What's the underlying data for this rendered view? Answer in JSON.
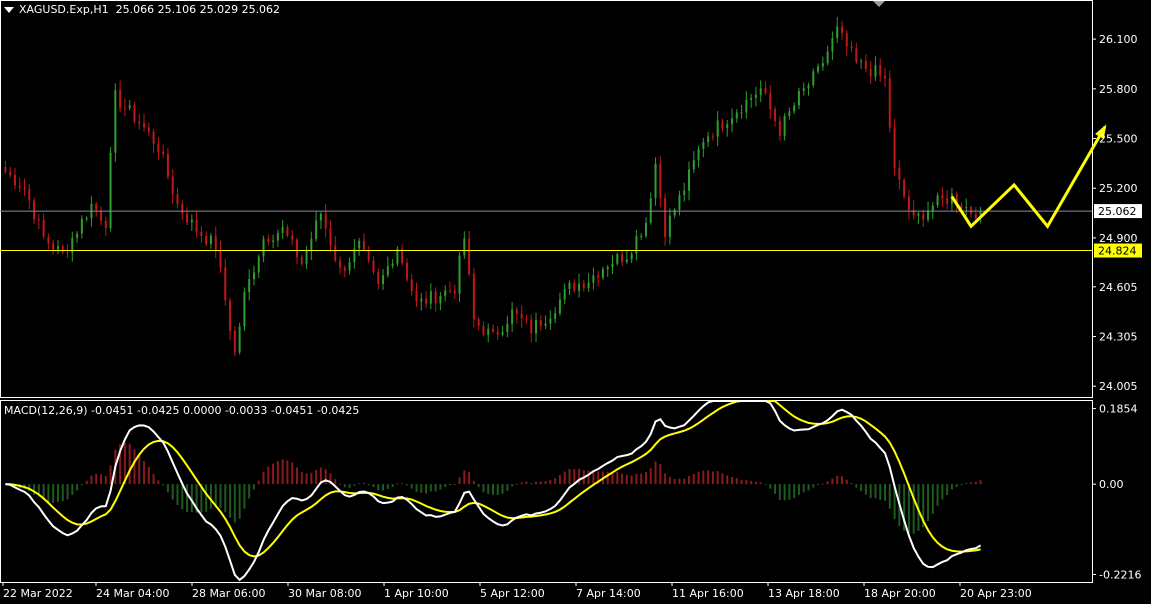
{
  "header": {
    "symbol": "XAGUSD.Exp,H1",
    "ohlc": "25.066 25.106 25.029 25.062",
    "macd_label": "MACD(12,26,9)",
    "macd_values": "-0.0451 -0.0425 0.0000 -0.0033 -0.0451 -0.0425"
  },
  "colors": {
    "background": "#000000",
    "bull": "#2e9e2e",
    "bear": "#c01818",
    "hist_pos": "#8b1a1a",
    "hist_neg": "#1f5a1f",
    "macd_line": "#ffffff",
    "signal_line": "#ffff00",
    "level_line": "#ffff00",
    "price_line": "#8a8aa8",
    "arrow": "#ffff00"
  },
  "chart_data": [
    {
      "type": "candlestick",
      "title": "XAGUSD.Exp,H1",
      "y_ticks": [
        "26.100",
        "25.800",
        "25.500",
        "25.200",
        "24.900",
        "24.605",
        "24.305",
        "24.005"
      ],
      "ylim": [
        23.94,
        26.33
      ],
      "x_ticks": [
        "22 Mar 2022",
        "24 Mar 04:00",
        "28 Mar 06:00",
        "30 Mar 08:00",
        "1 Apr 10:00",
        "5 Apr 12:00",
        "7 Apr 14:00",
        "11 Apr 16:00",
        "13 Apr 18:00",
        "18 Apr 20:00",
        "20 Apr 23:00"
      ],
      "current_price": 25.062,
      "current_price_label": "25.062",
      "horizontal_level": 24.824,
      "horizontal_level_label": "24.824",
      "price_path": [
        [
          0,
          25.3
        ],
        [
          4,
          25.2
        ],
        [
          8,
          24.9
        ],
        [
          12,
          24.8
        ],
        [
          18,
          25.1
        ],
        [
          21,
          25.0
        ],
        [
          23,
          25.75
        ],
        [
          28,
          25.6
        ],
        [
          32,
          25.45
        ],
        [
          36,
          25.1
        ],
        [
          40,
          24.95
        ],
        [
          44,
          24.85
        ],
        [
          48,
          24.2
        ],
        [
          50,
          24.55
        ],
        [
          54,
          24.9
        ],
        [
          58,
          24.95
        ],
        [
          62,
          24.75
        ],
        [
          66,
          25.05
        ],
        [
          70,
          24.7
        ],
        [
          74,
          24.85
        ],
        [
          78,
          24.6
        ],
        [
          82,
          24.85
        ],
        [
          86,
          24.5
        ],
        [
          90,
          24.55
        ],
        [
          94,
          24.6
        ],
        [
          96,
          24.9
        ],
        [
          98,
          24.4
        ],
        [
          102,
          24.3
        ],
        [
          106,
          24.45
        ],
        [
          110,
          24.35
        ],
        [
          114,
          24.45
        ],
        [
          118,
          24.6
        ],
        [
          122,
          24.65
        ],
        [
          126,
          24.75
        ],
        [
          130,
          24.8
        ],
        [
          134,
          25.0
        ],
        [
          136,
          25.35
        ],
        [
          138,
          24.95
        ],
        [
          142,
          25.2
        ],
        [
          146,
          25.5
        ],
        [
          150,
          25.6
        ],
        [
          154,
          25.7
        ],
        [
          158,
          25.8
        ],
        [
          162,
          25.55
        ],
        [
          166,
          25.75
        ],
        [
          170,
          25.9
        ],
        [
          174,
          26.15
        ],
        [
          178,
          25.95
        ],
        [
          182,
          25.9
        ],
        [
          184,
          25.85
        ],
        [
          186,
          25.3
        ],
        [
          190,
          25.0
        ],
        [
          194,
          25.1
        ],
        [
          198,
          25.15
        ],
        [
          202,
          25.062
        ]
      ],
      "projection_arrow": [
        [
          198,
          25.15
        ],
        [
          202,
          24.97
        ],
        [
          211,
          25.22
        ],
        [
          218,
          24.97
        ],
        [
          230,
          25.57
        ]
      ]
    },
    {
      "type": "macd",
      "title": "MACD(12,26,9)",
      "params": [
        12,
        26,
        9
      ],
      "y_ticks": [
        "0.1854",
        "0.00",
        "-0.2216"
      ],
      "ylim": [
        -0.24,
        0.204
      ]
    }
  ]
}
